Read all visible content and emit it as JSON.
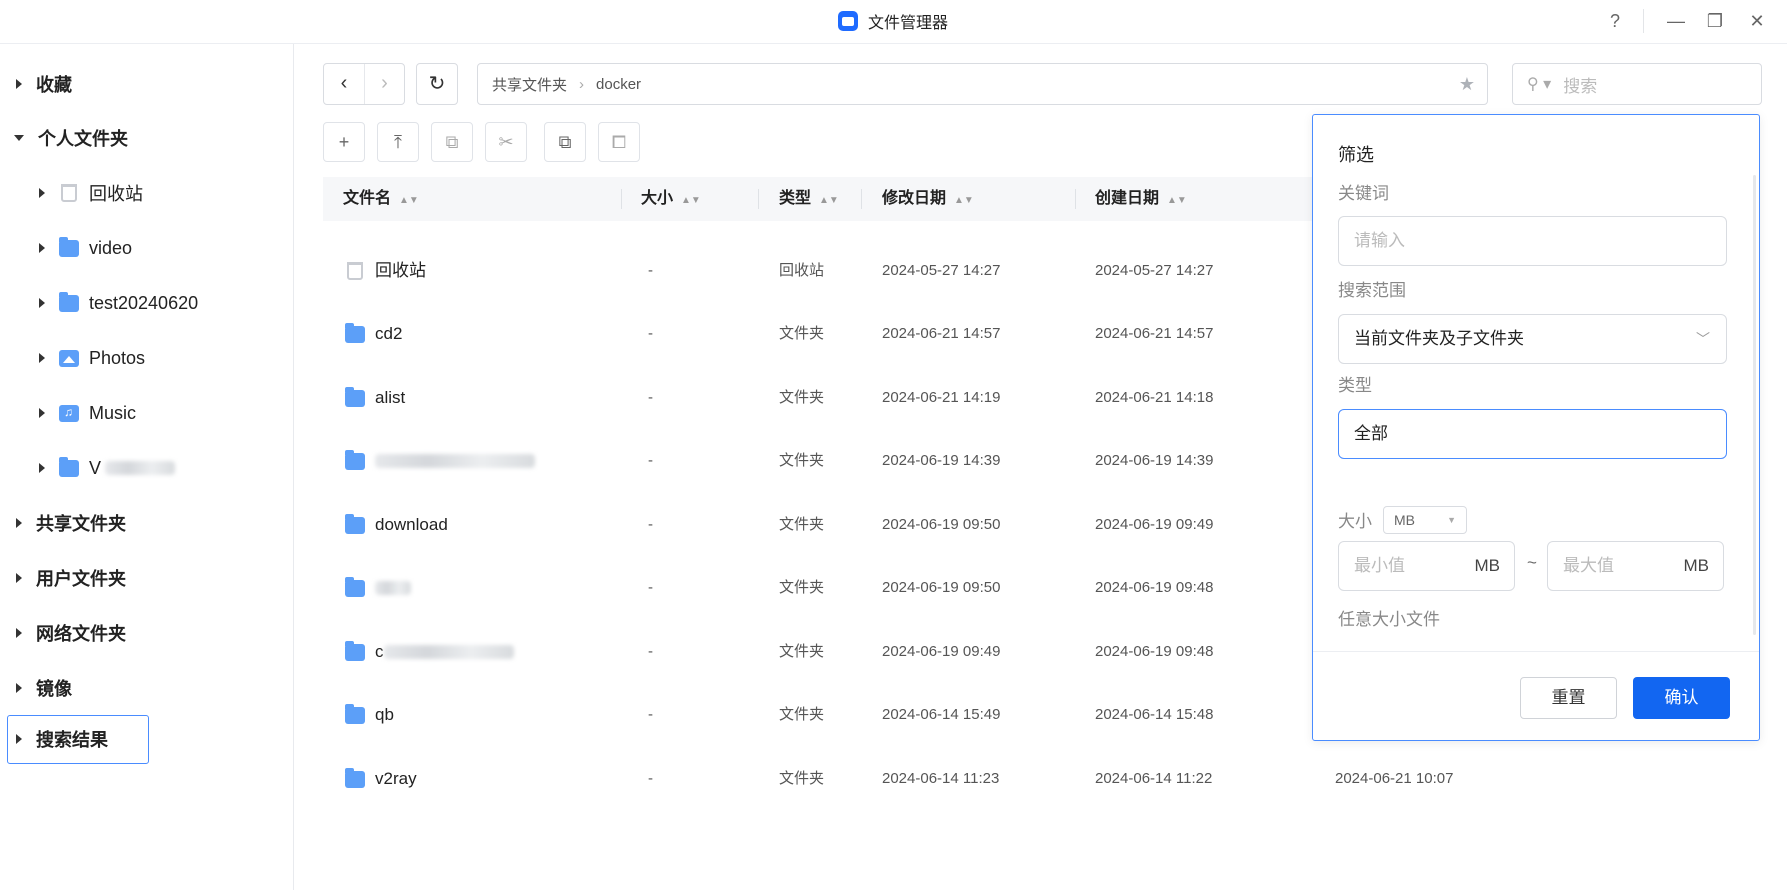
{
  "window": {
    "title": "文件管理器",
    "help_label": "?",
    "minimize_label": "—",
    "restore_label": "❐",
    "close_label": "✕"
  },
  "sidebar": {
    "favorites": "收藏",
    "personal": "个人文件夹",
    "personal_items": [
      "回收站",
      "video",
      "test20240620",
      "Photos",
      "Music",
      "V"
    ],
    "shared": "共享文件夹",
    "user": "用户文件夹",
    "network": "网络文件夹",
    "mirror": "镜像",
    "search_results": "搜索结果"
  },
  "toolbar": {
    "back": "‹",
    "forward": "›",
    "refresh": "↻",
    "breadcrumb": [
      "共享文件夹",
      "docker"
    ],
    "breadcrumb_sep": "›",
    "star": "★",
    "search_placeholder": "搜索",
    "actions": [
      "+",
      "⤒",
      "⧉",
      "✂",
      "⧉",
      "⧠"
    ]
  },
  "table": {
    "columns": [
      "文件名",
      "大小",
      "类型",
      "修改日期",
      "创建日期"
    ],
    "rows": [
      {
        "name": "回收站",
        "size": "-",
        "type": "回收站",
        "modified": "2024-05-27 14:27",
        "created": "2024-05-27 14:27",
        "accessed": "",
        "icon": "trash-icon"
      },
      {
        "name": "cd2",
        "size": "-",
        "type": "文件夹",
        "modified": "2024-06-21 14:57",
        "created": "2024-06-21 14:57",
        "accessed": "",
        "icon": "folder-icon"
      },
      {
        "name": "alist",
        "size": "-",
        "type": "文件夹",
        "modified": "2024-06-21 14:19",
        "created": "2024-06-21 14:18",
        "accessed": "",
        "icon": "folder-icon"
      },
      {
        "name": "",
        "size": "-",
        "type": "文件夹",
        "modified": "2024-06-19 14:39",
        "created": "2024-06-19 14:39",
        "accessed": "",
        "icon": "folder-icon"
      },
      {
        "name": "download",
        "size": "-",
        "type": "文件夹",
        "modified": "2024-06-19 09:50",
        "created": "2024-06-19 09:49",
        "accessed": "",
        "icon": "folder-icon"
      },
      {
        "name": "",
        "size": "-",
        "type": "文件夹",
        "modified": "2024-06-19 09:50",
        "created": "2024-06-19 09:48",
        "accessed": "",
        "icon": "folder-icon"
      },
      {
        "name": "c",
        "size": "-",
        "type": "文件夹",
        "modified": "2024-06-19 09:49",
        "created": "2024-06-19 09:48",
        "accessed": "",
        "icon": "folder-icon"
      },
      {
        "name": "qb",
        "size": "-",
        "type": "文件夹",
        "modified": "2024-06-14 15:49",
        "created": "2024-06-14 15:48",
        "accessed": "2024-06-21 10:07",
        "icon": "folder-icon"
      },
      {
        "name": "v2ray",
        "size": "-",
        "type": "文件夹",
        "modified": "2024-06-14 11:23",
        "created": "2024-06-14 11:22",
        "accessed": "2024-06-21 10:07",
        "icon": "folder-icon"
      }
    ]
  },
  "filter": {
    "title": "筛选",
    "keyword_label": "关键词",
    "keyword_placeholder": "请输入",
    "scope_label": "搜索范围",
    "scope_value": "当前文件夹及子文件夹",
    "type_label": "类型",
    "type_value": "全部",
    "size_label": "大小",
    "size_unit": "MB",
    "min_placeholder": "最小值",
    "max_placeholder": "最大值",
    "range_unit": "MB",
    "tilde": "~",
    "hint": "任意大小文件",
    "reset_label": "重置",
    "confirm_label": "确认"
  },
  "colors": {
    "accent": "#1266f1",
    "folder": "#5c9ff8",
    "focus_border": "#4a8cff"
  }
}
